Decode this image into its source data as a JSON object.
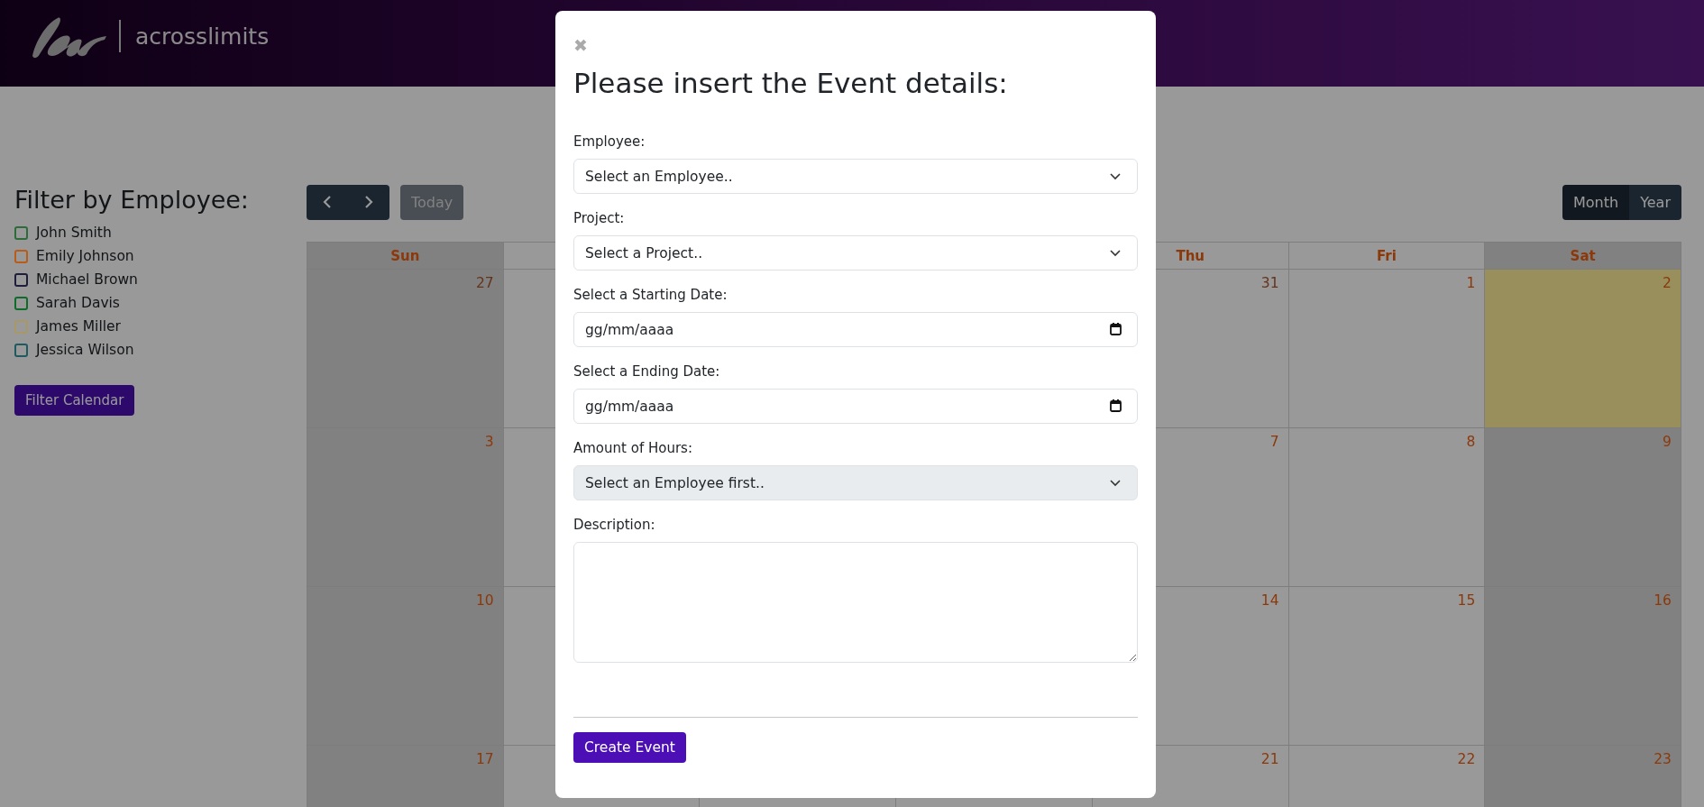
{
  "header": {
    "brand": "acrosslimits"
  },
  "sidebar": {
    "title": "Filter by Employee:",
    "employees": [
      {
        "name": "John Smith",
        "color": "#2e6b3a",
        "checked": false
      },
      {
        "name": "Emily Johnson",
        "color": "#b85c1a",
        "checked": false
      },
      {
        "name": "Michael Brown",
        "color": "#1e1e3c",
        "checked": false
      },
      {
        "name": "Sarah Davis",
        "color": "#0e6b2a",
        "checked": false
      },
      {
        "name": "James Miller",
        "color": "#a89868",
        "checked": false
      },
      {
        "name": "Jessica Wilson",
        "color": "#1e5a60",
        "checked": false
      }
    ],
    "button": "Filter Calendar"
  },
  "toolbar": {
    "today": "Today",
    "today_disabled": true,
    "views": [
      {
        "label": "Month",
        "selected": true
      },
      {
        "label": "Year",
        "selected": false
      }
    ]
  },
  "calendar": {
    "weekdays": {
      "sun": {
        "label": "Sun",
        "weekend": true
      },
      "thu": {
        "label": "Thu",
        "weekend": false
      },
      "fri": {
        "label": "Fri",
        "weekend": false
      },
      "sat": {
        "label": "Sat",
        "weekend": true
      }
    },
    "weeks": [
      {
        "sun": {
          "day": "27",
          "outside": true,
          "today": false
        },
        "thu": {
          "day": "31",
          "outside": true,
          "today": false
        },
        "fri": {
          "day": "1",
          "outside": false,
          "today": false
        },
        "sat": {
          "day": "2",
          "outside": false,
          "today": true
        }
      },
      {
        "sun": {
          "day": "3",
          "outside": false,
          "today": false
        },
        "thu": {
          "day": "7",
          "outside": false,
          "today": false
        },
        "fri": {
          "day": "8",
          "outside": false,
          "today": false
        },
        "sat": {
          "day": "9",
          "outside": false,
          "today": false
        }
      },
      {
        "sun": {
          "day": "10",
          "outside": false,
          "today": false
        },
        "thu": {
          "day": "14",
          "outside": false,
          "today": false
        },
        "fri": {
          "day": "15",
          "outside": false,
          "today": false
        },
        "sat": {
          "day": "16",
          "outside": false,
          "today": false
        }
      },
      {
        "sun": {
          "day": "17",
          "outside": false,
          "today": false
        },
        "thu": {
          "day": "21",
          "outside": false,
          "today": false
        },
        "fri": {
          "day": "22",
          "outside": false,
          "today": false
        },
        "sat": {
          "day": "23",
          "outside": false,
          "today": false
        }
      }
    ]
  },
  "modal": {
    "close": "✖",
    "title": "Please insert the Event details:",
    "fields": [
      {
        "kind": "select",
        "label": "Employee:",
        "placeholder": "Select an Employee..",
        "disabled": false
      },
      {
        "kind": "select",
        "label": "Project:",
        "placeholder": "Select a Project..",
        "disabled": false
      },
      {
        "kind": "date",
        "label": "Select a Starting Date:",
        "placeholder": "gg/mm/aaaa",
        "disabled": false
      },
      {
        "kind": "date",
        "label": "Select a Ending Date:",
        "placeholder": "gg/mm/aaaa",
        "disabled": false
      },
      {
        "kind": "select",
        "label": "Amount of Hours:",
        "placeholder": "Select an Employee first..",
        "disabled": true
      },
      {
        "kind": "textarea",
        "label": "Description:",
        "disabled": false
      }
    ],
    "button": "Create Event"
  }
}
